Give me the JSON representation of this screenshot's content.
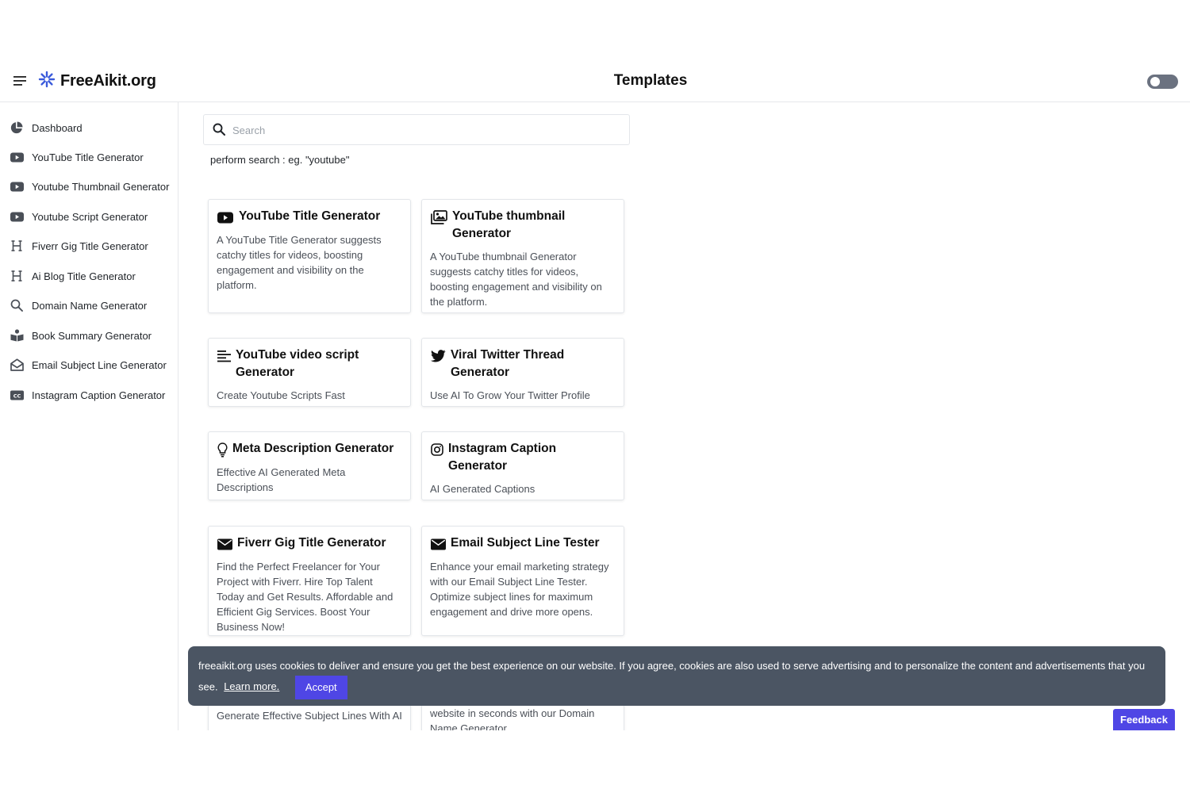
{
  "app": {
    "name": "FreeAikit.org",
    "page_title": "Templates"
  },
  "colors": {
    "accent": "#4f46e5",
    "cookie_bg": "#4b5563",
    "logo_blue": "#3b5bdb"
  },
  "sidebar": {
    "items": [
      {
        "label": "Dashboard",
        "icon": "pie-chart-icon"
      },
      {
        "label": "YouTube Title Generator",
        "icon": "youtube-icon"
      },
      {
        "label": "Youtube Thumbnail Generator",
        "icon": "youtube-icon"
      },
      {
        "label": "Youtube Script Generator",
        "icon": "youtube-icon"
      },
      {
        "label": "Fiverr Gig Title Generator",
        "icon": "heading-icon"
      },
      {
        "label": "Ai Blog Title Generator",
        "icon": "heading-icon"
      },
      {
        "label": "Domain Name Generator",
        "icon": "search-icon"
      },
      {
        "label": "Book Summary Generator",
        "icon": "book-reader-icon"
      },
      {
        "label": "Email Subject Line Generator",
        "icon": "envelope-open-icon"
      },
      {
        "label": "Instagram Caption Generator",
        "icon": "closed-caption-icon"
      }
    ]
  },
  "search": {
    "placeholder": "Search",
    "value": "",
    "hint": "perform search : eg. \"youtube\""
  },
  "cards": [
    {
      "title": "YouTube Title Generator",
      "icon": "youtube-icon",
      "description": "A YouTube Title Generator suggests catchy titles for videos, boosting engagement and visibility on the platform."
    },
    {
      "title": "YouTube thumbnail Generator",
      "icon": "images-icon",
      "description": "A YouTube thumbnail Generator suggests catchy titles for videos, boosting engagement and visibility on the platform."
    },
    {
      "title": "YouTube video script Generator",
      "icon": "align-left-icon",
      "description": "Create Youtube Scripts Fast"
    },
    {
      "title": "Viral Twitter Thread Generator",
      "icon": "twitter-icon",
      "description": "Use AI To Grow Your Twitter Profile"
    },
    {
      "title": "Meta Description Generator",
      "icon": "lightbulb-icon",
      "description": "Effective AI Generated Meta Descriptions"
    },
    {
      "title": "Instagram Caption Generator",
      "icon": "instagram-icon",
      "description": "AI Generated Captions"
    },
    {
      "title": "Fiverr Gig Title Generator",
      "icon": "envelope-icon",
      "description": "Find the Perfect Freelancer for Your Project with Fiverr. Hire Top Talent Today and Get Results. Affordable and Efficient Gig Services. Boost Your Business Now!"
    },
    {
      "title": "Email Subject Line Tester",
      "icon": "envelope-icon",
      "description": "Enhance your email marketing strategy with our Email Subject Line Tester. Optimize subject lines for maximum engagement and drive more opens."
    },
    {
      "title": "",
      "icon": "",
      "description": "Generate Effective Subject Lines With AI"
    },
    {
      "title": "",
      "icon": "",
      "description": "website in seconds with our Domain Name Generator."
    }
  ],
  "cookie": {
    "text": "freeaikit.org uses cookies to deliver and ensure you get the best experience on our website. If you agree, cookies are also used to serve advertising and to personalize the content and advertisements that you see.",
    "learn_more": "Learn more.",
    "accept": "Accept"
  },
  "feedback": {
    "label": "Feedback"
  }
}
